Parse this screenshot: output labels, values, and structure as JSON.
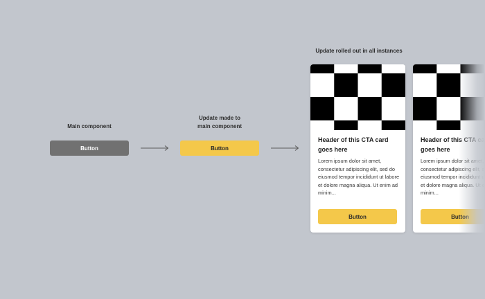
{
  "labels": {
    "main_component": "Main component",
    "update_made": [
      "Update made to",
      "main component"
    ],
    "rolled_out": "Update rolled out in all instances"
  },
  "main_button": {
    "label": "Button",
    "color": "#717171"
  },
  "updated_button": {
    "label": "Button",
    "color": "#f4c84a"
  },
  "cards": [
    {
      "title": "Header of this CTA card goes here",
      "body": "Lorem ipsum dolor sit amet, consectetur adipiscing elit, sed do eiusmod tempor incididunt ut labore et dolore magna aliqua. Ut enim ad minim...",
      "button_label": "Button"
    },
    {
      "title": "Header of this CTA card goes here",
      "body": "Lorem ipsum dolor sit amet, consectetur adipiscing elit, sed do eiusmod tempor incididunt ut labore et dolore magna aliqua. Ut enim ad minim...",
      "button_label": "Button"
    }
  ],
  "colors": {
    "background": "#c2c6cd",
    "accent_yellow": "#f4c84a",
    "main_gray": "#717171"
  },
  "icons": {
    "arrow": "arrow-right-icon",
    "card_image": "checkerboard-image"
  }
}
